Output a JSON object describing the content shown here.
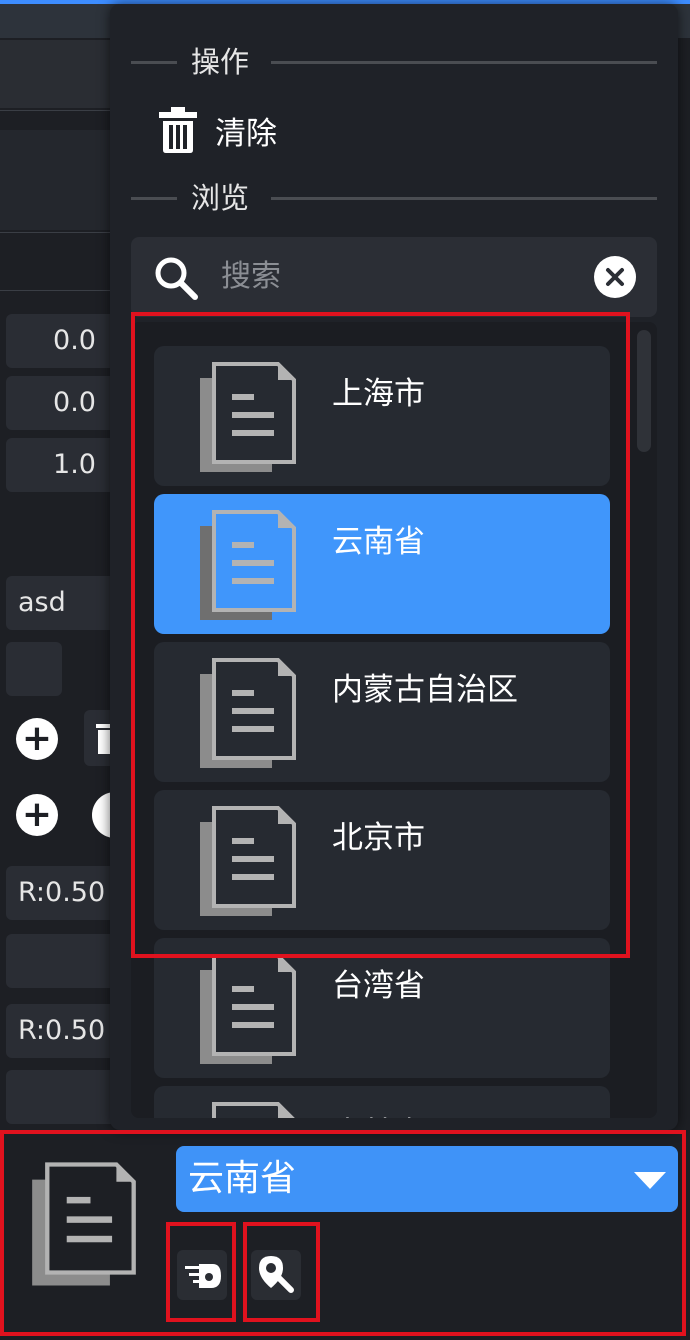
{
  "background_panel": {
    "fields": [
      "0.0",
      "0.0",
      "1.0"
    ],
    "text_field": "asd",
    "color_fields": [
      "R:0.50",
      "R:0.50"
    ]
  },
  "menu": {
    "section_operations": "操作",
    "clear_label": "清除",
    "section_browse": "浏览",
    "search_placeholder": "搜索",
    "items": [
      {
        "label": "上海市"
      },
      {
        "label": "云南省"
      },
      {
        "label": "内蒙古自治区"
      },
      {
        "label": "北京市"
      },
      {
        "label": "台湾省"
      },
      {
        "label": "吉林省"
      }
    ],
    "selected_index": 1
  },
  "picker": {
    "selected_value": "云南省"
  },
  "colors": {
    "accent": "#4096fb",
    "highlight": "#e0121e"
  }
}
